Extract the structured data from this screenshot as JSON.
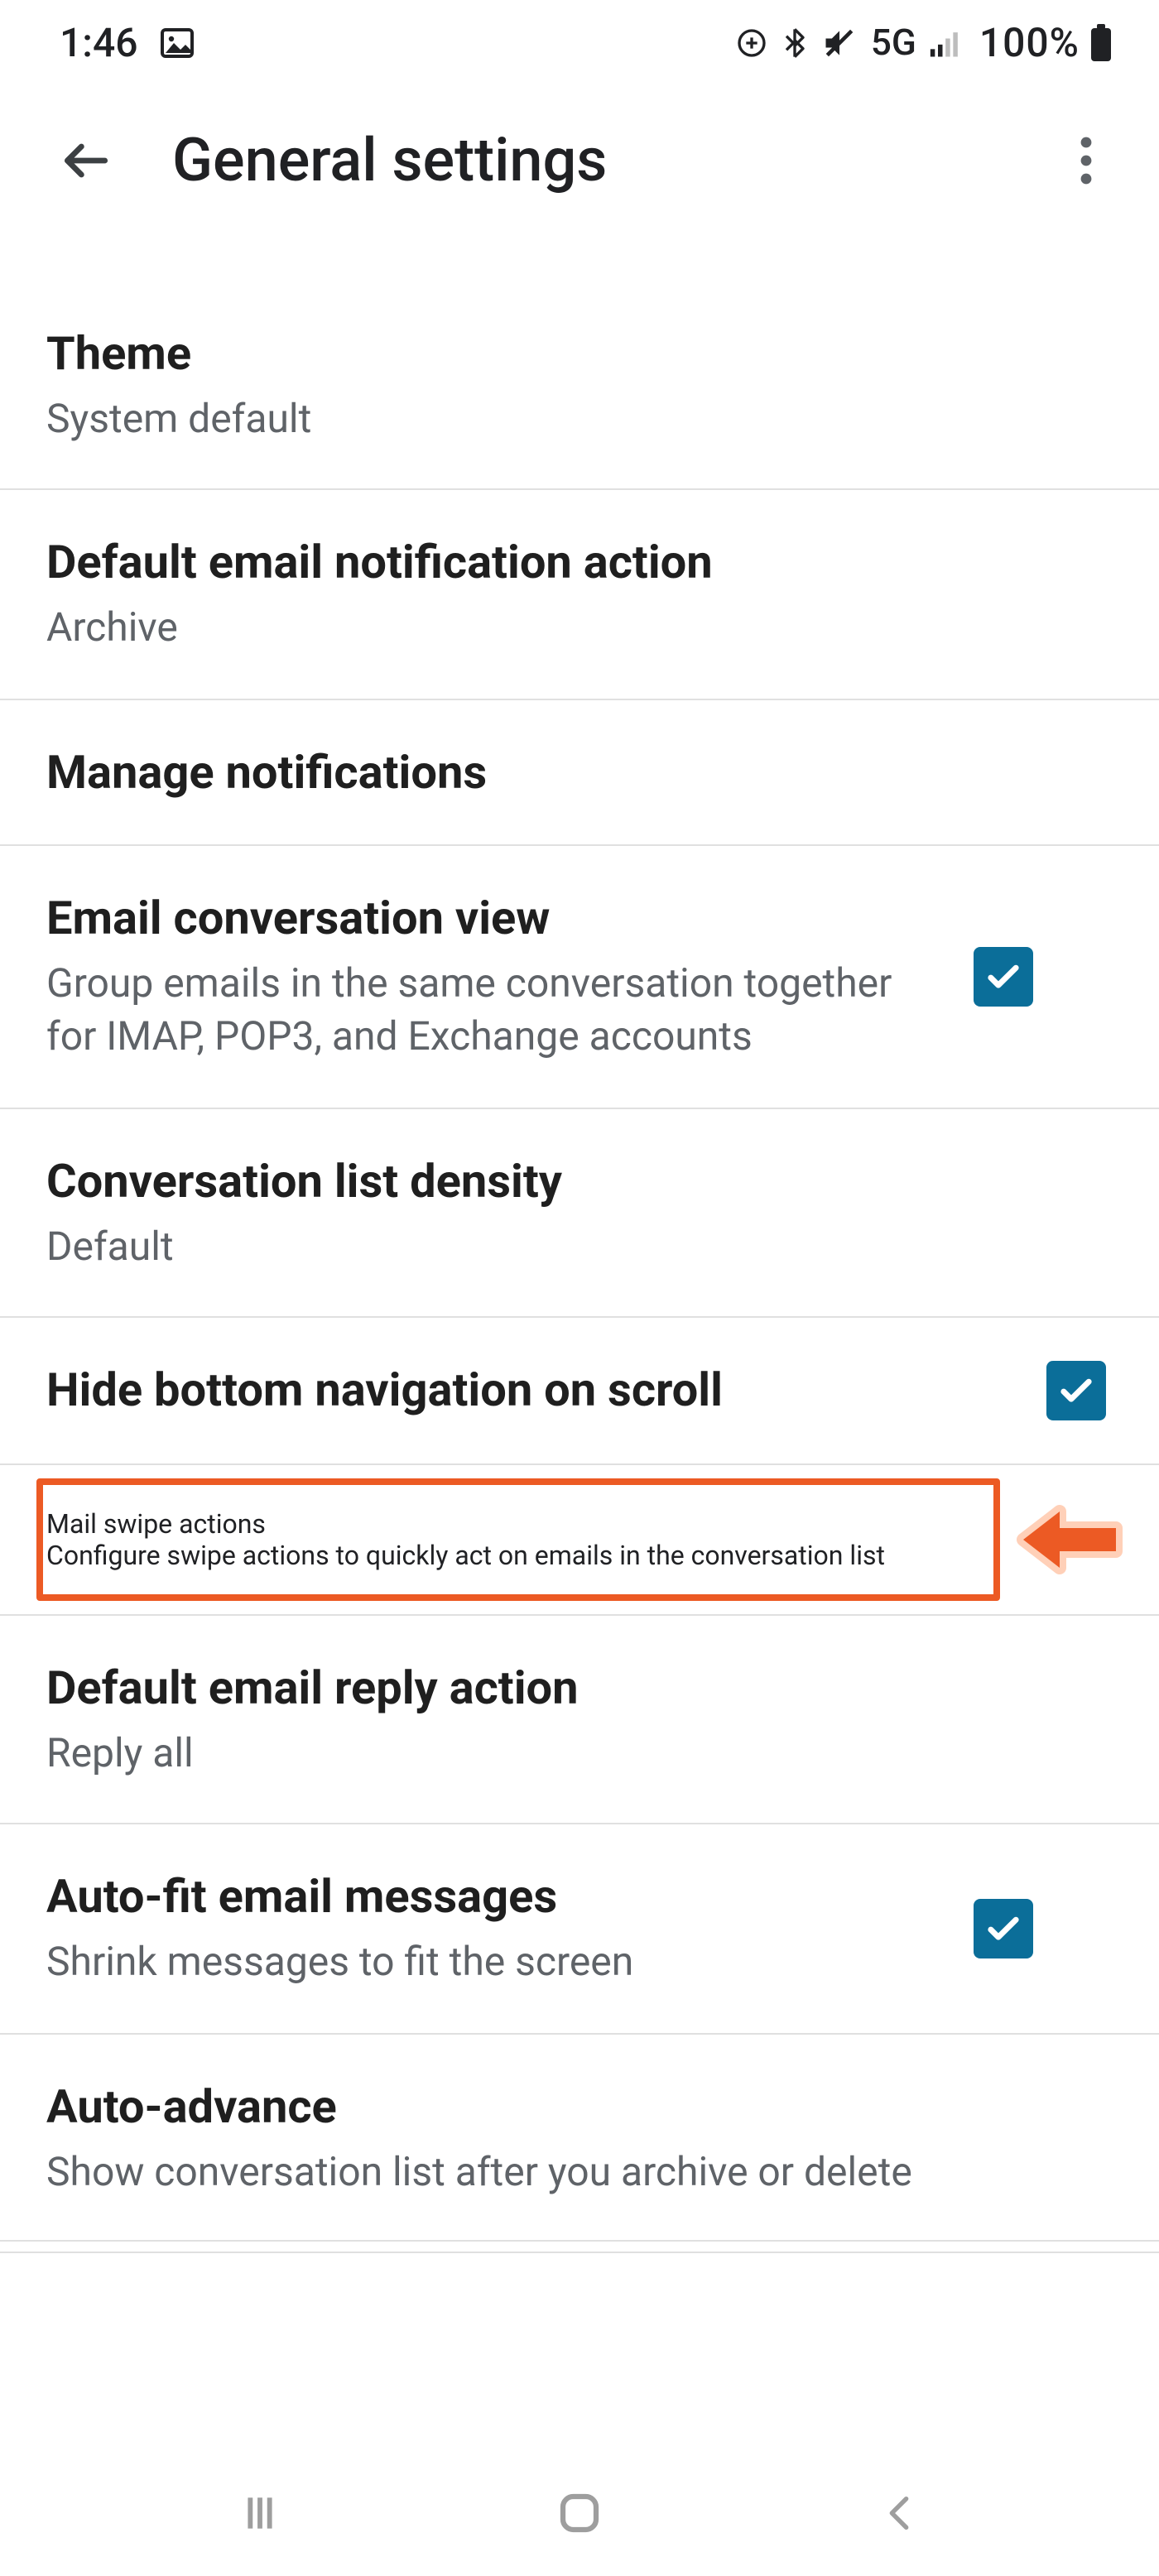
{
  "status": {
    "time": "1:46",
    "network_label": "5G",
    "battery_pct": "100%"
  },
  "appbar": {
    "title": "General settings"
  },
  "rows": {
    "theme": {
      "title": "Theme",
      "sub": "System default"
    },
    "default_notif": {
      "title": "Default email notification action",
      "sub": "Archive"
    },
    "manage_notif": {
      "title": "Manage notifications"
    },
    "conv_view": {
      "title": "Email conversation view",
      "sub": "Group emails in the same conversation together for IMAP, POP3, and Exchange accounts"
    },
    "density": {
      "title": "Conversation list density",
      "sub": "Default"
    },
    "hide_nav": {
      "title": "Hide bottom navigation on scroll"
    },
    "swipe": {
      "title": "Mail swipe actions",
      "sub": "Configure swipe actions to quickly act on emails in the conversation list"
    },
    "reply": {
      "title": "Default email reply action",
      "sub": "Reply all"
    },
    "autofit": {
      "title": "Auto-fit email messages",
      "sub": "Shrink messages to fit the screen"
    },
    "autoadvance": {
      "title": "Auto-advance",
      "sub": "Show conversation list after you archive or delete"
    }
  },
  "checkbox_states": {
    "conv_view": true,
    "hide_nav": true,
    "autofit": true
  },
  "colors": {
    "checkbox": "#0b6e99",
    "highlight": "#ec5a24",
    "arrow_glow": "#ffd0b8"
  }
}
